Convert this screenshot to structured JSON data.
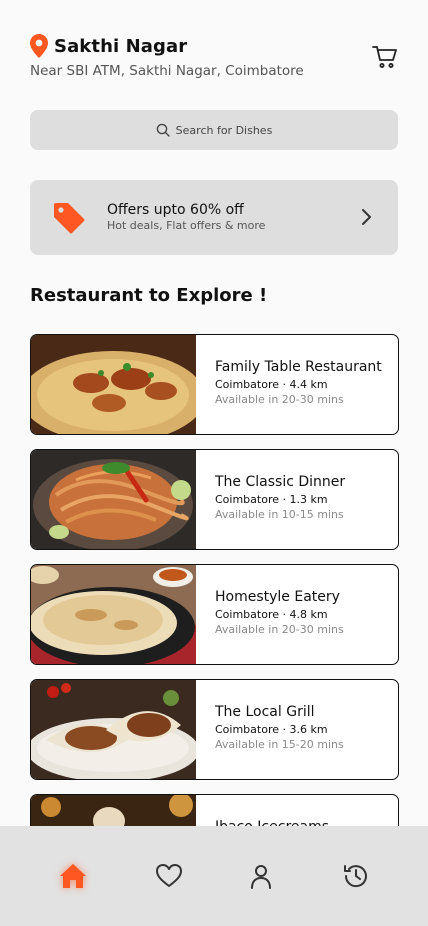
{
  "location": {
    "title": "Sakthi Nagar",
    "subtitle": "Near SBI ATM, Sakthi Nagar, Coimbatore"
  },
  "search": {
    "placeholder": "Search for Dishes"
  },
  "offers": {
    "title": "Offers upto 60% off",
    "subtitle": "Hot deals, Flat offers & more"
  },
  "section_title": "Restaurant to Explore !",
  "restaurants": [
    {
      "name": "Family Table Restaurant",
      "meta": "Coimbatore · 4.4 km",
      "time": "Available in 20-30 mins"
    },
    {
      "name": "The Classic Dinner",
      "meta": "Coimbatore · 1.3 km",
      "time": "Available in 10-15 mins"
    },
    {
      "name": "Homestyle Eatery",
      "meta": "Coimbatore · 4.8 km",
      "time": "Available in 20-30 mins"
    },
    {
      "name": "The Local Grill",
      "meta": "Coimbatore · 3.6 km",
      "time": "Available in 15-20 mins"
    },
    {
      "name": "Ibaco Icecreams",
      "meta": "",
      "time": ""
    }
  ],
  "nav": [
    "home-icon",
    "heart-icon",
    "user-icon",
    "history-icon"
  ],
  "colors": {
    "accent": "#ff5722",
    "card_border": "#111111",
    "panel": "#dedede",
    "nav_bg": "#e2e2e2"
  }
}
